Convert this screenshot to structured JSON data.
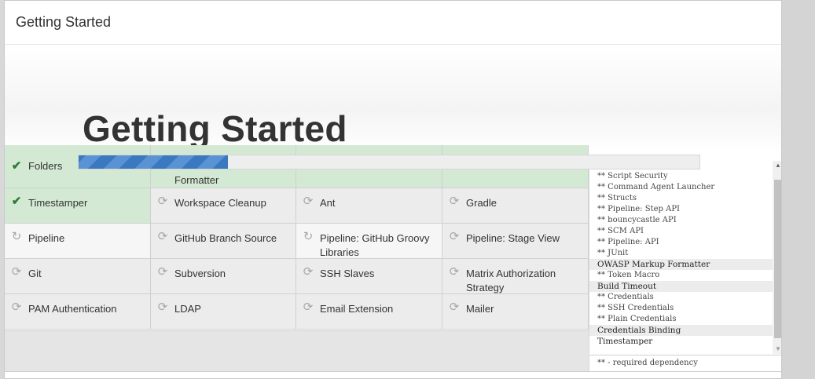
{
  "header": {
    "title": "Getting Started"
  },
  "hero": {
    "title": "Getting Started"
  },
  "progress": {
    "fraction": 0.24
  },
  "plugins": [
    {
      "label": "Folders",
      "status": "success",
      "icon": "checkmark-icon"
    },
    {
      "label": "Formatter",
      "status": "success",
      "icon": "checkmark-icon"
    },
    {
      "label": "",
      "status": "success",
      "icon": "none"
    },
    {
      "label": "",
      "status": "success",
      "icon": "none"
    },
    {
      "label": "Timestamper",
      "status": "success",
      "icon": "checkmark-icon"
    },
    {
      "label": "Workspace Cleanup",
      "status": "pending",
      "icon": "refresh-icon"
    },
    {
      "label": "Ant",
      "status": "pending",
      "icon": "refresh-icon"
    },
    {
      "label": "Gradle",
      "status": "pending",
      "icon": "refresh-icon"
    },
    {
      "label": "Pipeline",
      "status": "installing",
      "icon": "sync-icon"
    },
    {
      "label": "GitHub Branch Source",
      "status": "pending",
      "icon": "refresh-icon"
    },
    {
      "label": "Pipeline: GitHub Groovy Libraries",
      "status": "installing",
      "icon": "sync-icon"
    },
    {
      "label": "Pipeline: Stage View",
      "status": "pending",
      "icon": "refresh-icon"
    },
    {
      "label": "Git",
      "status": "pending",
      "icon": "refresh-icon"
    },
    {
      "label": "Subversion",
      "status": "pending",
      "icon": "refresh-icon"
    },
    {
      "label": "SSH Slaves",
      "status": "pending",
      "icon": "refresh-icon"
    },
    {
      "label": "Matrix Authorization Strategy",
      "status": "pending",
      "icon": "refresh-icon"
    },
    {
      "label": "PAM Authentication",
      "status": "pending",
      "icon": "refresh-icon"
    },
    {
      "label": "LDAP",
      "status": "pending",
      "icon": "refresh-icon"
    },
    {
      "label": "Email Extension",
      "status": "pending",
      "icon": "refresh-icon"
    },
    {
      "label": "Mailer",
      "status": "pending",
      "icon": "refresh-icon"
    }
  ],
  "log": {
    "lines": [
      {
        "text": "** Script Security",
        "type": "dep"
      },
      {
        "text": "** Command Agent Launcher",
        "type": "dep"
      },
      {
        "text": "** Structs",
        "type": "dep"
      },
      {
        "text": "** Pipeline: Step API",
        "type": "dep"
      },
      {
        "text": "** bouncycastle API",
        "type": "dep"
      },
      {
        "text": "** SCM API",
        "type": "dep"
      },
      {
        "text": "** Pipeline: API",
        "type": "dep"
      },
      {
        "text": "** JUnit",
        "type": "dep"
      },
      {
        "text": "OWASP Markup Formatter",
        "type": "plugin"
      },
      {
        "text": "** Token Macro",
        "type": "dep"
      },
      {
        "text": "Build Timeout",
        "type": "plugin"
      },
      {
        "text": "** Credentials",
        "type": "dep"
      },
      {
        "text": "** SSH Credentials",
        "type": "dep"
      },
      {
        "text": "** Plain Credentials",
        "type": "dep"
      },
      {
        "text": "Credentials Binding",
        "type": "plugin"
      },
      {
        "text": "Timestamper",
        "type": "plugin-current"
      }
    ],
    "footer": "** - required dependency"
  },
  "colors": {
    "success_bg": "#d3e9d3",
    "pending_bg": "#ececec",
    "progress_blue": "#3a78c0",
    "check_green": "#2e7d32"
  }
}
